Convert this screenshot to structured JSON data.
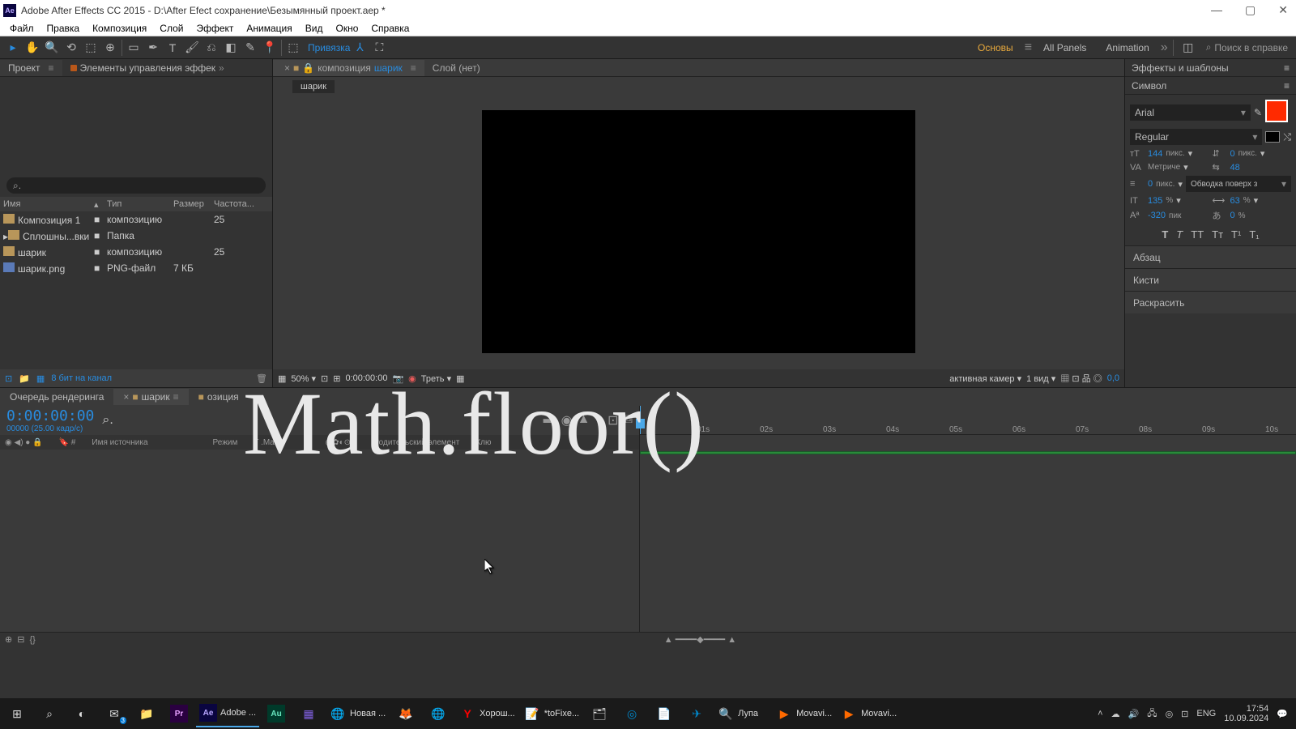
{
  "window": {
    "title": "Adobe After Effects CC 2015 - D:\\After Efect сохранение\\Безымянный проект.aep *",
    "app_badge": "Ae"
  },
  "menu": [
    "Файл",
    "Правка",
    "Композиция",
    "Слой",
    "Эффект",
    "Анимация",
    "Вид",
    "Окно",
    "Справка"
  ],
  "toolbar": {
    "snap_label": "Привязка"
  },
  "workspaces": {
    "items": [
      "Основы",
      "All Panels",
      "Animation"
    ],
    "active": 0,
    "search_placeholder": "Поиск в справке"
  },
  "project": {
    "tab": "Проект",
    "tab2": "Элементы управления эффек",
    "search": "⌕.",
    "headers": [
      "Имя",
      "",
      "Тип",
      "Размер",
      "Частота..."
    ],
    "rows": [
      {
        "name": "Композиция 1",
        "type": "композицию",
        "size": "",
        "rate": "25",
        "icon": "comp"
      },
      {
        "name": "Сплошны...вки",
        "type": "Папка",
        "size": "",
        "rate": "",
        "icon": "folder",
        "expand": "▸"
      },
      {
        "name": "шарик",
        "type": "композицию",
        "size": "",
        "rate": "25",
        "icon": "comp"
      },
      {
        "name": "шарик.png",
        "type": "PNG-файл",
        "size": "7 КБ",
        "rate": "",
        "icon": "png"
      }
    ],
    "footer_bits": "8 бит на канал"
  },
  "viewer": {
    "tab_prefix": "композиция",
    "tab_comp": "шарик",
    "tab_layer": "Слой (нет)",
    "breadcrumb": "шарик",
    "footer": {
      "zoom": "50%",
      "time": "0:00:00:00",
      "quality": "Треть",
      "camera": "активная камер",
      "views": "1 вид",
      "coord": "0,0"
    }
  },
  "right": {
    "effects_label": "Эффекты и шаблоны",
    "char": {
      "title": "Символ",
      "font": "Arial",
      "style": "Regular",
      "size": "144",
      "size_unit": "пикс.",
      "leading": "0",
      "leading_unit": "пикс.",
      "kerning": "Метриче",
      "tracking": "48",
      "stroke_w": "0",
      "stroke_unit": "пикс.",
      "stroke_mode": "Обводка поверх з",
      "vscale": "135",
      "vscale_unit": "%",
      "hscale": "63",
      "hscale_unit": "%",
      "baseline": "-320",
      "baseline_unit": "пик",
      "tsume": "0",
      "tsume_unit": "%",
      "fill_color": "#ff2a00"
    },
    "accordions": [
      "Абзац",
      "Кисти",
      "Раскрасить"
    ]
  },
  "timeline": {
    "tabs": {
      "render": "Очередь рендеринга",
      "comp": "шарик",
      "other": "озиция"
    },
    "timecode": "0:00:00:00",
    "tc_sub": "00000 (25.00 кадр/с)",
    "col_source": "Имя источника",
    "col_mode": "Режим",
    "col_trkmat": "T .Mat",
    "col_parent": "Родительский элемент",
    "col_keys": "Клю",
    "ticks": [
      "01s",
      "02s",
      "03s",
      "04s",
      "05s",
      "06s",
      "07s",
      "08s",
      "09s",
      "10s"
    ]
  },
  "taskbar": {
    "items": [
      {
        "icon": "⊞",
        "label": ""
      },
      {
        "icon": "⌕",
        "label": ""
      },
      {
        "icon": "◐",
        "label": ""
      },
      {
        "icon": "✉",
        "label": "",
        "badge": "3"
      },
      {
        "icon": "📁",
        "label": ""
      },
      {
        "icon": "Pr",
        "label": ""
      },
      {
        "icon": "Ae",
        "label": "Adobe ...",
        "active": true
      },
      {
        "icon": "Au",
        "label": ""
      },
      {
        "icon": "▦",
        "label": ""
      },
      {
        "icon": "◉",
        "label": "Новая ...",
        "chrome": true
      },
      {
        "icon": "🦊",
        "label": ""
      },
      {
        "icon": "🌐",
        "label": ""
      },
      {
        "icon": "Y",
        "label": "Хорош..."
      },
      {
        "icon": "📝",
        "label": "*toFixe..."
      },
      {
        "icon": "🗂",
        "label": ""
      },
      {
        "icon": "◎",
        "label": ""
      },
      {
        "icon": "📄",
        "label": ""
      },
      {
        "icon": "✈",
        "label": ""
      },
      {
        "icon": "🔍",
        "label": "Лупа"
      },
      {
        "icon": "▶",
        "label": "Movavi..."
      },
      {
        "icon": "▶",
        "label": "Movavi..."
      }
    ],
    "tray": {
      "lang": "ENG",
      "time": "17:54",
      "date": "10.09.2024"
    }
  },
  "overlay": "Math.floor()"
}
